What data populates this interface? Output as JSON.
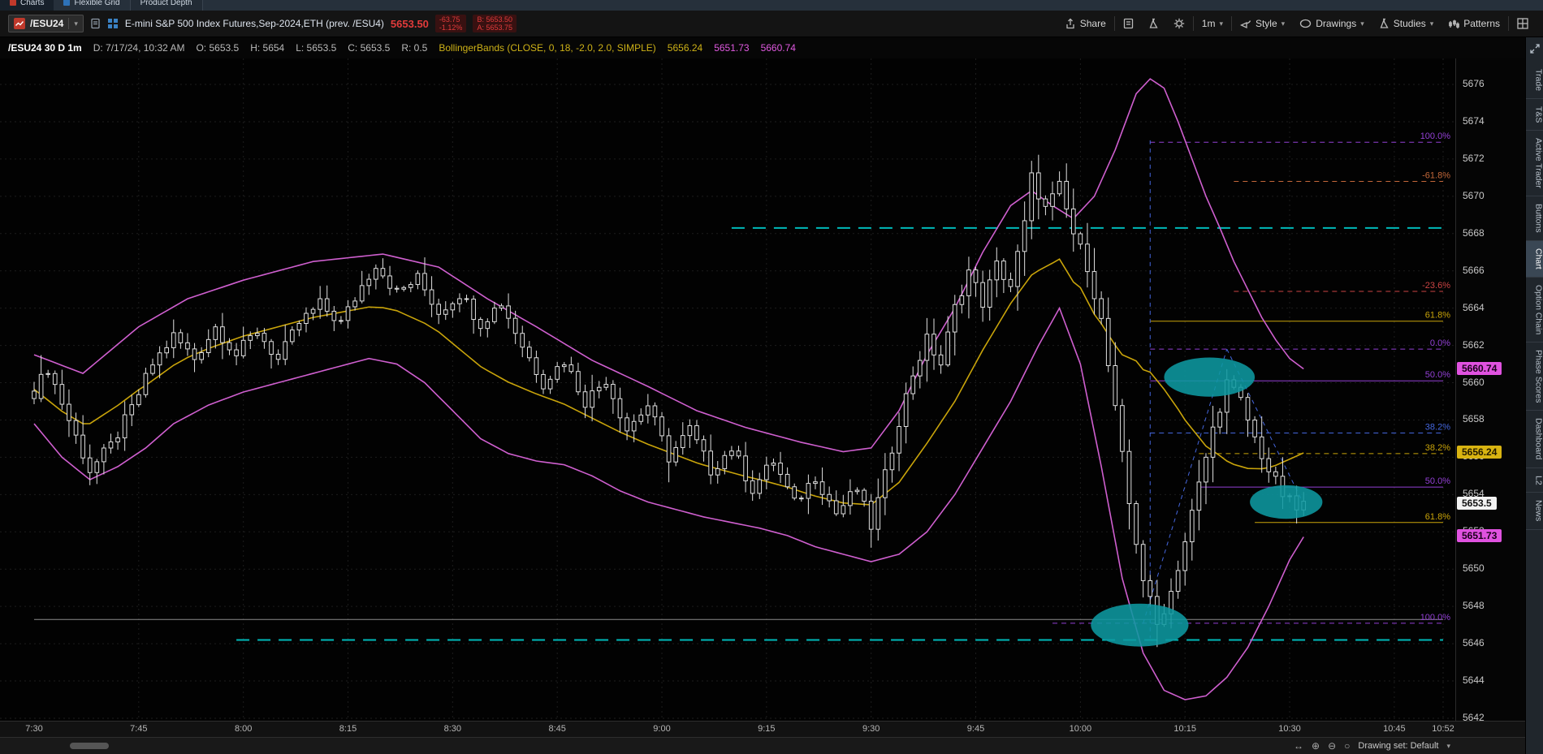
{
  "app": {
    "drawing_set_label": "Drawing set: Default"
  },
  "top_tabs": {
    "items": [
      "Charts",
      "Flexible Grid",
      "Product Depth"
    ],
    "active": "Charts"
  },
  "toolbar": {
    "symbol": "/ESU24",
    "description": "E-mini S&P 500 Index Futures,Sep-2024,ETH (prev. /ESU4)",
    "last_price": "5653.50",
    "change": "-63.75",
    "change_percent": "-1.12%",
    "bid": "B: 5653.50",
    "ask": "A: 5653.75",
    "share_label": "Share",
    "timeframe_label": "1m",
    "style_label": "Style",
    "drawings_label": "Drawings",
    "studies_label": "Studies",
    "patterns_label": "Patterns"
  },
  "infobar": {
    "summary": "/ESU24 30 D 1m",
    "datetime": "D: 7/17/24, 10:32 AM",
    "open": "O: 5653.5",
    "high": "H: 5654",
    "low": "L: 5653.5",
    "close": "C: 5653.5",
    "range": "R: 0.5",
    "study": "BollingerBands (CLOSE, 0, 18, -2.0, 2.0, SIMPLE)",
    "study_values": {
      "mid": "5656.24",
      "lower": "5651.73",
      "upper": "5660.74"
    }
  },
  "right_tabs": {
    "items": [
      "Trade",
      "T&S",
      "Active Trader",
      "Buttons",
      "Chart",
      "Option Chain",
      "Phase Scores",
      "Dashboard",
      "L2",
      "News"
    ],
    "selected": "Chart"
  },
  "chart_data": {
    "type": "candlestick",
    "symbol": "/ESU24",
    "period": "30 D 1m",
    "y_axis": {
      "min": 5642,
      "max": 5676,
      "step": 2
    },
    "minutes_total": 202,
    "minutes_data": 183,
    "x_ticks": [
      [
        0,
        "7:30"
      ],
      [
        15,
        "7:45"
      ],
      [
        30,
        "8:00"
      ],
      [
        45,
        "8:15"
      ],
      [
        60,
        "8:30"
      ],
      [
        75,
        "8:45"
      ],
      [
        90,
        "9:00"
      ],
      [
        105,
        "9:15"
      ],
      [
        120,
        "9:30"
      ],
      [
        135,
        "9:45"
      ],
      [
        150,
        "10:00"
      ],
      [
        165,
        "10:15"
      ],
      [
        180,
        "10:30"
      ],
      [
        195,
        "10:45"
      ],
      [
        202,
        "10:52"
      ]
    ],
    "series": {
      "close_waypoints": [
        [
          0,
          5659.5
        ],
        [
          2,
          5660.8
        ],
        [
          5,
          5658.0
        ],
        [
          8,
          5655.3
        ],
        [
          11,
          5656.6
        ],
        [
          14,
          5658.6
        ],
        [
          17,
          5661.0
        ],
        [
          20,
          5662.5
        ],
        [
          23,
          5661.3
        ],
        [
          26,
          5663.0
        ],
        [
          29,
          5661.5
        ],
        [
          32,
          5662.8
        ],
        [
          35,
          5661.2
        ],
        [
          38,
          5663.2
        ],
        [
          41,
          5664.2
        ],
        [
          44,
          5663.2
        ],
        [
          47,
          5665.2
        ],
        [
          49,
          5666.4
        ],
        [
          52,
          5664.8
        ],
        [
          55,
          5665.6
        ],
        [
          58,
          5663.8
        ],
        [
          61,
          5664.8
        ],
        [
          64,
          5663.2
        ],
        [
          67,
          5664.3
        ],
        [
          70,
          5662.0
        ],
        [
          73,
          5660.0
        ],
        [
          76,
          5661.2
        ],
        [
          79,
          5659.0
        ],
        [
          82,
          5660.2
        ],
        [
          85,
          5657.5
        ],
        [
          88,
          5658.8
        ],
        [
          91,
          5656.0
        ],
        [
          94,
          5657.5
        ],
        [
          97,
          5655.3
        ],
        [
          100,
          5656.5
        ],
        [
          103,
          5654.3
        ],
        [
          106,
          5655.8
        ],
        [
          109,
          5653.5
        ],
        [
          112,
          5655.0
        ],
        [
          115,
          5653.0
        ],
        [
          118,
          5654.3
        ],
        [
          120,
          5652.3
        ],
        [
          122,
          5655.0
        ],
        [
          124,
          5658.0
        ],
        [
          126,
          5660.5
        ],
        [
          128,
          5662.3
        ],
        [
          130,
          5661.0
        ],
        [
          132,
          5664.0
        ],
        [
          134,
          5666.0
        ],
        [
          136,
          5664.3
        ],
        [
          138,
          5666.3
        ],
        [
          140,
          5665.2
        ],
        [
          142,
          5668.5
        ],
        [
          143,
          5671.0
        ],
        [
          145,
          5669.3
        ],
        [
          147,
          5670.5
        ],
        [
          149,
          5668.0
        ],
        [
          151,
          5666.3
        ],
        [
          153,
          5663.3
        ],
        [
          155,
          5658.5
        ],
        [
          157,
          5653.5
        ],
        [
          159,
          5649.5
        ],
        [
          161,
          5647.0
        ],
        [
          163,
          5648.8
        ],
        [
          165,
          5651.5
        ],
        [
          167,
          5654.5
        ],
        [
          169,
          5657.5
        ],
        [
          171,
          5660.0
        ],
        [
          173,
          5659.0
        ],
        [
          175,
          5657.0
        ],
        [
          177,
          5655.3
        ],
        [
          179,
          5654.0
        ],
        [
          181,
          5653.2
        ],
        [
          182,
          5653.5
        ]
      ],
      "bollinger_upper": [
        [
          0,
          5661.5
        ],
        [
          7,
          5660.5
        ],
        [
          15,
          5663.0
        ],
        [
          22,
          5664.5
        ],
        [
          30,
          5665.5
        ],
        [
          40,
          5666.5
        ],
        [
          50,
          5666.9
        ],
        [
          58,
          5666.2
        ],
        [
          65,
          5664.5
        ],
        [
          72,
          5663.0
        ],
        [
          80,
          5661.2
        ],
        [
          88,
          5659.8
        ],
        [
          95,
          5658.5
        ],
        [
          102,
          5657.6
        ],
        [
          110,
          5656.8
        ],
        [
          116,
          5656.3
        ],
        [
          120,
          5656.5
        ],
        [
          124,
          5658.5
        ],
        [
          128,
          5661.5
        ],
        [
          132,
          5664.0
        ],
        [
          136,
          5667.0
        ],
        [
          140,
          5669.5
        ],
        [
          143,
          5670.3
        ],
        [
          146,
          5669.5
        ],
        [
          149,
          5668.8
        ],
        [
          152,
          5670.0
        ],
        [
          155,
          5672.5
        ],
        [
          158,
          5675.5
        ],
        [
          160,
          5676.3
        ],
        [
          162,
          5675.8
        ],
        [
          164,
          5674.0
        ],
        [
          166,
          5672.0
        ],
        [
          168,
          5670.0
        ],
        [
          170,
          5668.3
        ],
        [
          172,
          5666.5
        ],
        [
          174,
          5665.0
        ],
        [
          176,
          5663.5
        ],
        [
          178,
          5662.3
        ],
        [
          180,
          5661.3
        ],
        [
          182,
          5660.74
        ]
      ],
      "bollinger_lower": [
        [
          0,
          5657.8
        ],
        [
          4,
          5656.0
        ],
        [
          8,
          5654.8
        ],
        [
          12,
          5655.5
        ],
        [
          16,
          5656.5
        ],
        [
          20,
          5657.8
        ],
        [
          25,
          5658.8
        ],
        [
          30,
          5659.5
        ],
        [
          35,
          5660.0
        ],
        [
          40,
          5660.5
        ],
        [
          45,
          5661.0
        ],
        [
          48,
          5661.3
        ],
        [
          52,
          5661.0
        ],
        [
          56,
          5660.0
        ],
        [
          60,
          5658.5
        ],
        [
          64,
          5657.0
        ],
        [
          68,
          5656.2
        ],
        [
          72,
          5655.8
        ],
        [
          76,
          5655.6
        ],
        [
          80,
          5655.0
        ],
        [
          84,
          5654.2
        ],
        [
          88,
          5653.6
        ],
        [
          92,
          5653.2
        ],
        [
          96,
          5652.8
        ],
        [
          100,
          5652.5
        ],
        [
          104,
          5652.2
        ],
        [
          108,
          5651.8
        ],
        [
          112,
          5651.2
        ],
        [
          116,
          5650.8
        ],
        [
          120,
          5650.4
        ],
        [
          124,
          5650.8
        ],
        [
          128,
          5652.0
        ],
        [
          132,
          5654.0
        ],
        [
          136,
          5656.5
        ],
        [
          140,
          5659.0
        ],
        [
          144,
          5662.0
        ],
        [
          147,
          5664.0
        ],
        [
          150,
          5661.0
        ],
        [
          153,
          5655.5
        ],
        [
          156,
          5649.5
        ],
        [
          159,
          5645.5
        ],
        [
          162,
          5643.5
        ],
        [
          165,
          5643.0
        ],
        [
          168,
          5643.2
        ],
        [
          171,
          5644.2
        ],
        [
          174,
          5645.8
        ],
        [
          177,
          5648.0
        ],
        [
          180,
          5650.5
        ],
        [
          182,
          5651.73
        ]
      ]
    },
    "fib_levels": [
      {
        "t_start": 160,
        "price": 5672.9,
        "label": "100.0%",
        "color": "#9340d5",
        "dash": true
      },
      {
        "t_start": 172,
        "price": 5670.8,
        "label": "-61.8%",
        "color": "#c4683a",
        "dash": true
      },
      {
        "t_start": 172,
        "price": 5664.9,
        "label": "-23.6%",
        "color": "#cc4444",
        "dash": true
      },
      {
        "t_start": 160,
        "price": 5663.3,
        "label": "61.8%",
        "color": "#c9a40a",
        "dash": false
      },
      {
        "t_start": 160,
        "price": 5661.8,
        "label": "0.0%",
        "color": "#9340d5",
        "dash": true
      },
      {
        "t_start": 160,
        "price": 5660.1,
        "label": "50.0%",
        "color": "#9340d5",
        "dash": false
      },
      {
        "t_start": 160,
        "price": 5657.3,
        "label": "38.2%",
        "color": "#4466dd",
        "dash": true
      },
      {
        "t_start": 167,
        "price": 5656.2,
        "label": "38.2%",
        "color": "#c9a40a",
        "dash": true
      },
      {
        "t_start": 167,
        "price": 5654.4,
        "label": "50.0%",
        "color": "#9340d5",
        "dash": false
      },
      {
        "t_start": 175,
        "price": 5652.5,
        "label": "61.8%",
        "color": "#c9a40a",
        "dash": false
      },
      {
        "t_start": 146,
        "price": 5647.1,
        "label": "100.0%",
        "color": "#9340d5",
        "dash": true
      }
    ],
    "h_lines": [
      {
        "price": 5668.3,
        "t_start": 100,
        "t_end": 202,
        "color": "#00b9b9",
        "dash": "16,10",
        "width": 2
      },
      {
        "price": 5646.2,
        "t_start": 29,
        "t_end": 202,
        "color": "#00b9b9",
        "dash": "16,10",
        "width": 2
      },
      {
        "price": 5647.3,
        "t_start": 0,
        "t_end": 202,
        "color": "#8a8a8a",
        "dash": "",
        "width": 1
      }
    ],
    "v_lines": [
      {
        "t": 160,
        "p1": 5673.0,
        "p2": 5646.3,
        "color": "#4466dd",
        "dash": "5,5"
      }
    ],
    "diag_lines": [
      {
        "t1": 159,
        "p1": 5647.1,
        "t2": 171,
        "p2": 5661.8,
        "color": "#4466dd",
        "dash": "5,5"
      },
      {
        "t1": 171,
        "p1": 5661.8,
        "t2": 182,
        "p2": 5653.5,
        "color": "#4466dd",
        "dash": "5,5"
      }
    ],
    "ellipses": [
      {
        "t": 168.5,
        "price": 5660.3,
        "rt": 6.5,
        "rp": 1.05
      },
      {
        "t": 179.5,
        "price": 5653.6,
        "rt": 5.2,
        "rp": 0.9
      },
      {
        "t": 158.5,
        "price": 5647.0,
        "rt": 7.0,
        "rp": 1.15
      }
    ],
    "price_bubbles": [
      {
        "label": "5660.74",
        "price": 5660.74,
        "bg": "#e052e0",
        "fg": "#1a001a"
      },
      {
        "label": "5656.24",
        "price": 5656.24,
        "bg": "#d9b411",
        "fg": "#221a00"
      },
      {
        "label": "5653.5",
        "price": 5653.5,
        "bg": "#f2f2f2",
        "fg": "#111111"
      },
      {
        "label": "5651.73",
        "price": 5651.73,
        "bg": "#e052e0",
        "fg": "#1a001a"
      }
    ],
    "colors": {
      "candle": "#e0e0e0",
      "boll_band": "#cf5fcf",
      "boll_mid": "#c9a40a",
      "ellipse": "#0e98a0",
      "teal": "#00b9b9",
      "grid": "#1d1d1d"
    }
  }
}
